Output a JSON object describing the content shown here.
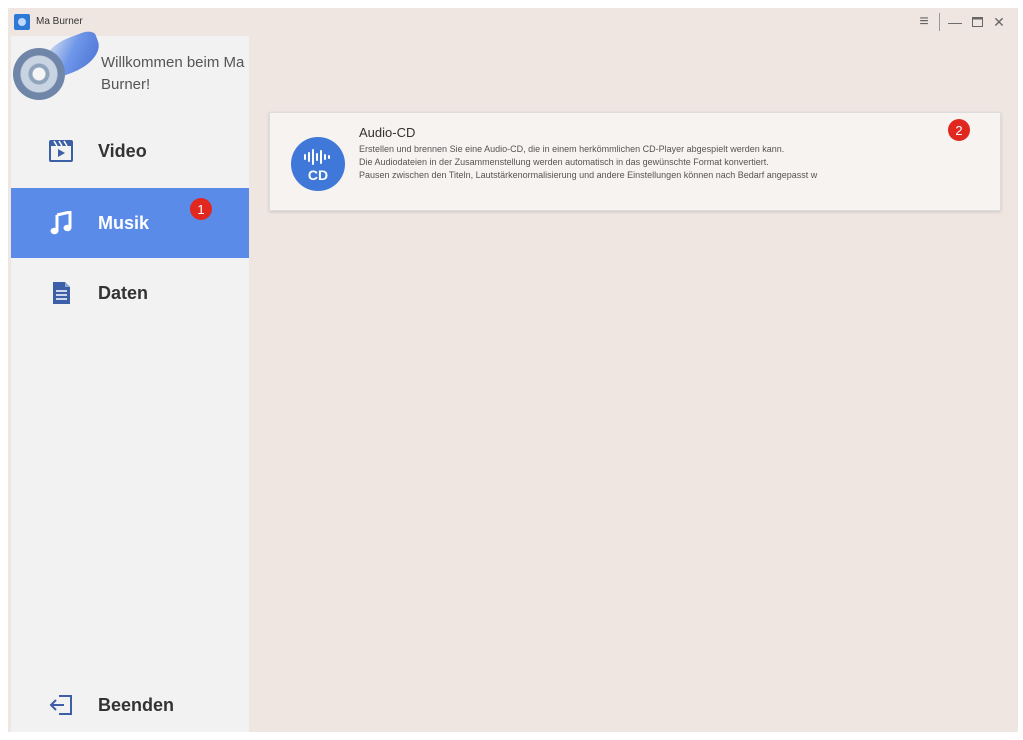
{
  "window": {
    "title": "Ma Burner"
  },
  "sidebar": {
    "welcome": "Willkommen beim Ma Burner!",
    "items": [
      {
        "label": "Video",
        "icon": "film-icon"
      },
      {
        "label": "Musik",
        "icon": "music-note-icon",
        "active": true,
        "badge": "1"
      },
      {
        "label": "Daten",
        "icon": "document-icon"
      }
    ],
    "exit_label": "Beenden"
  },
  "card": {
    "title": "Audio-CD",
    "icon_text": "CD",
    "badge": "2",
    "desc_line1": "Erstellen und brennen Sie eine Audio-CD, die in einem herkömmlichen CD-Player abgespielt werden kann.",
    "desc_line2": "Die Audiodateien in der Zusammenstellung werden automatisch in das gewünschte Format konvertiert.",
    "desc_line3": "Pausen zwischen den Titeln, Lautstärkenormalisierung und andere Einstellungen können nach Bedarf angepasst w"
  },
  "colors": {
    "accent": "#5a8be8",
    "badge": "#e0281f",
    "icon_blue": "#3f78d8"
  }
}
